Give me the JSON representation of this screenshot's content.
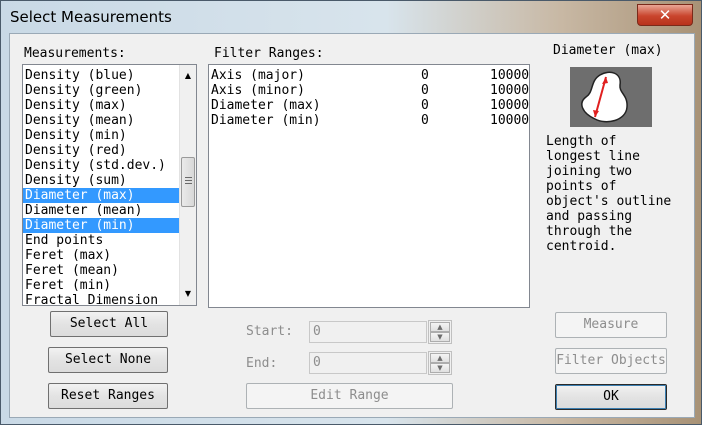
{
  "window": {
    "title": "Select Measurements",
    "close_glyph": "✕"
  },
  "measurements": {
    "label": "Measurements:",
    "items": [
      {
        "label": "Density (blue)",
        "selected": false
      },
      {
        "label": "Density (green)",
        "selected": false
      },
      {
        "label": "Density (max)",
        "selected": false
      },
      {
        "label": "Density (mean)",
        "selected": false
      },
      {
        "label": "Density (min)",
        "selected": false
      },
      {
        "label": "Density (red)",
        "selected": false
      },
      {
        "label": "Density (std.dev.)",
        "selected": false
      },
      {
        "label": "Density (sum)",
        "selected": false
      },
      {
        "label": "Diameter (max)",
        "selected": true
      },
      {
        "label": "Diameter (mean)",
        "selected": false
      },
      {
        "label": "Diameter (min)",
        "selected": true
      },
      {
        "label": "End points",
        "selected": false
      },
      {
        "label": "Feret (max)",
        "selected": false
      },
      {
        "label": "Feret (mean)",
        "selected": false
      },
      {
        "label": "Feret (min)",
        "selected": false
      },
      {
        "label": "Fractal Dimension",
        "selected": false
      }
    ]
  },
  "filter": {
    "label": "Filter Ranges:",
    "rows": [
      {
        "name": "Axis (major)",
        "min": "0",
        "max": "10000"
      },
      {
        "name": "Axis (minor)",
        "min": "0",
        "max": "10000"
      },
      {
        "name": "Diameter (max)",
        "min": "0",
        "max": "10000"
      },
      {
        "name": "Diameter (min)",
        "min": "0",
        "max": "10000"
      }
    ]
  },
  "buttons": {
    "select_all": "Select All",
    "select_none": "Select None",
    "reset_ranges": "Reset Ranges",
    "edit_range": "Edit Range",
    "measure": "Measure",
    "filter_objects": "Filter Objects",
    "ok": "OK"
  },
  "range": {
    "start_label": "Start:",
    "start_value": "0",
    "end_label": "End:",
    "end_value": "0"
  },
  "info": {
    "title": "Diameter (max)",
    "icon": "diameter-max-preview-icon",
    "description_lines": [
      "Length of",
      "longest line",
      "joining two",
      "points of",
      "object's outline",
      "and passing",
      "through the",
      "centroid."
    ]
  },
  "colors": {
    "selection": "#3399ff",
    "close": "#c9452d",
    "preview_bg": "#6e6e6e",
    "diameter_line": "#e02020"
  }
}
